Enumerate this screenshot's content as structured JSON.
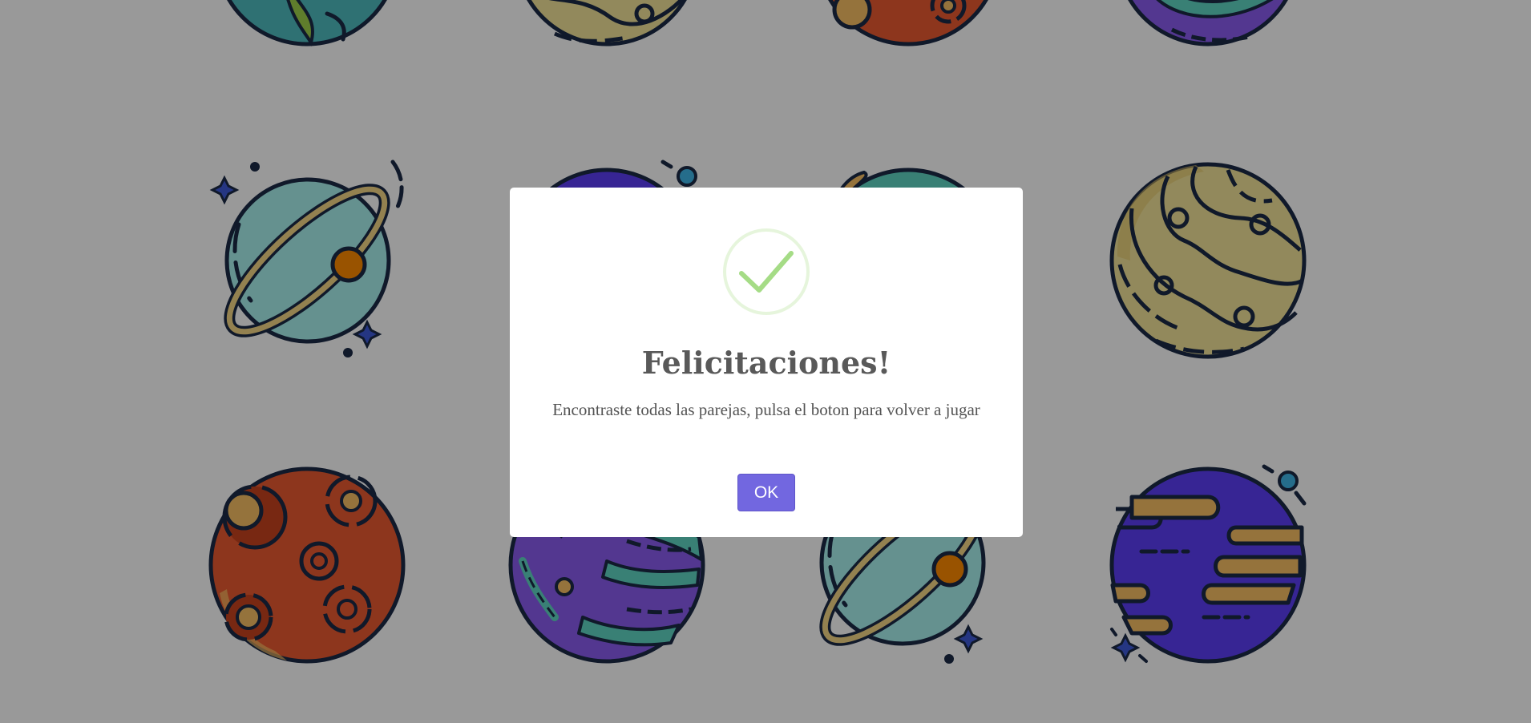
{
  "board": {
    "cards": [
      {
        "planet": "green-continent-planet"
      },
      {
        "planet": "tan-banded-planet"
      },
      {
        "planet": "red-crater-planet"
      },
      {
        "planet": "purple-striped-planet"
      },
      {
        "planet": "ringed-teal-planet"
      },
      {
        "planet": "indigo-gas-planet"
      },
      {
        "planet": "teal-yellow-planet"
      },
      {
        "planet": "tan-banded-planet"
      },
      {
        "planet": "red-crater-planet"
      },
      {
        "planet": "purple-striped-planet"
      },
      {
        "planet": "ringed-teal-planet"
      },
      {
        "planet": "indigo-gas-planet"
      }
    ]
  },
  "modal": {
    "icon": "success-check-icon",
    "title": "Felicitaciones!",
    "text": "Encontraste todas las parejas, pulsa el boton para volver a jugar",
    "confirm_label": "OK",
    "colors": {
      "check": "#a5dc86",
      "check_ring": "#e6f5dc",
      "confirm": "#7267e0",
      "overlay": "rgba(0,0,0,0.4)"
    }
  }
}
